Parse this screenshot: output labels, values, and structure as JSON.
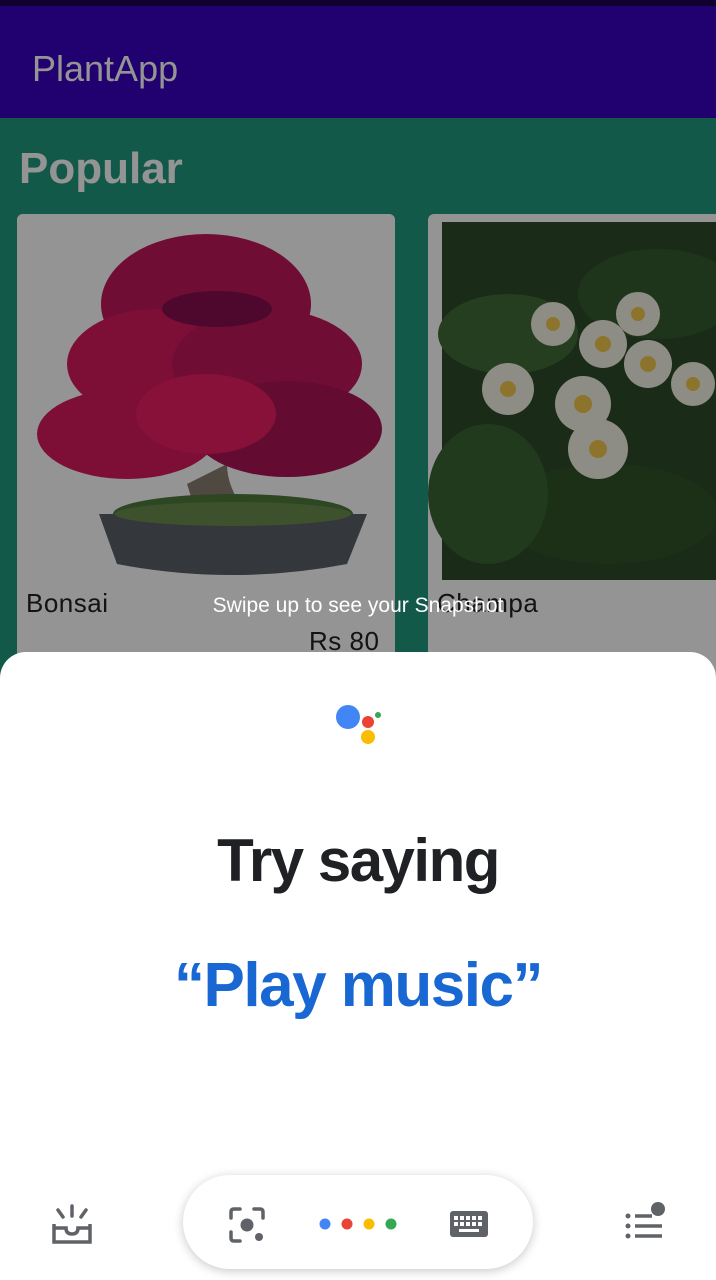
{
  "app": {
    "title": "PlantApp",
    "section_title": "Popular",
    "plants": [
      {
        "name": "Bonsai",
        "price": "Rs 80"
      },
      {
        "name": "Champa",
        "price": ""
      }
    ]
  },
  "assistant": {
    "hint": "Swipe up to see your Snapshot",
    "heading": "Try saying",
    "suggestion": "“Play music”",
    "icons": {
      "left": "snapshot-inbox-icon",
      "lens": "lens-icon",
      "keyboard": "keyboard-icon",
      "right": "updates-list-icon"
    },
    "colors": {
      "blue": "#4285f4",
      "red": "#ea4335",
      "yellow": "#fbbc04",
      "green": "#34a853",
      "suggestion": "#1967d2"
    }
  }
}
